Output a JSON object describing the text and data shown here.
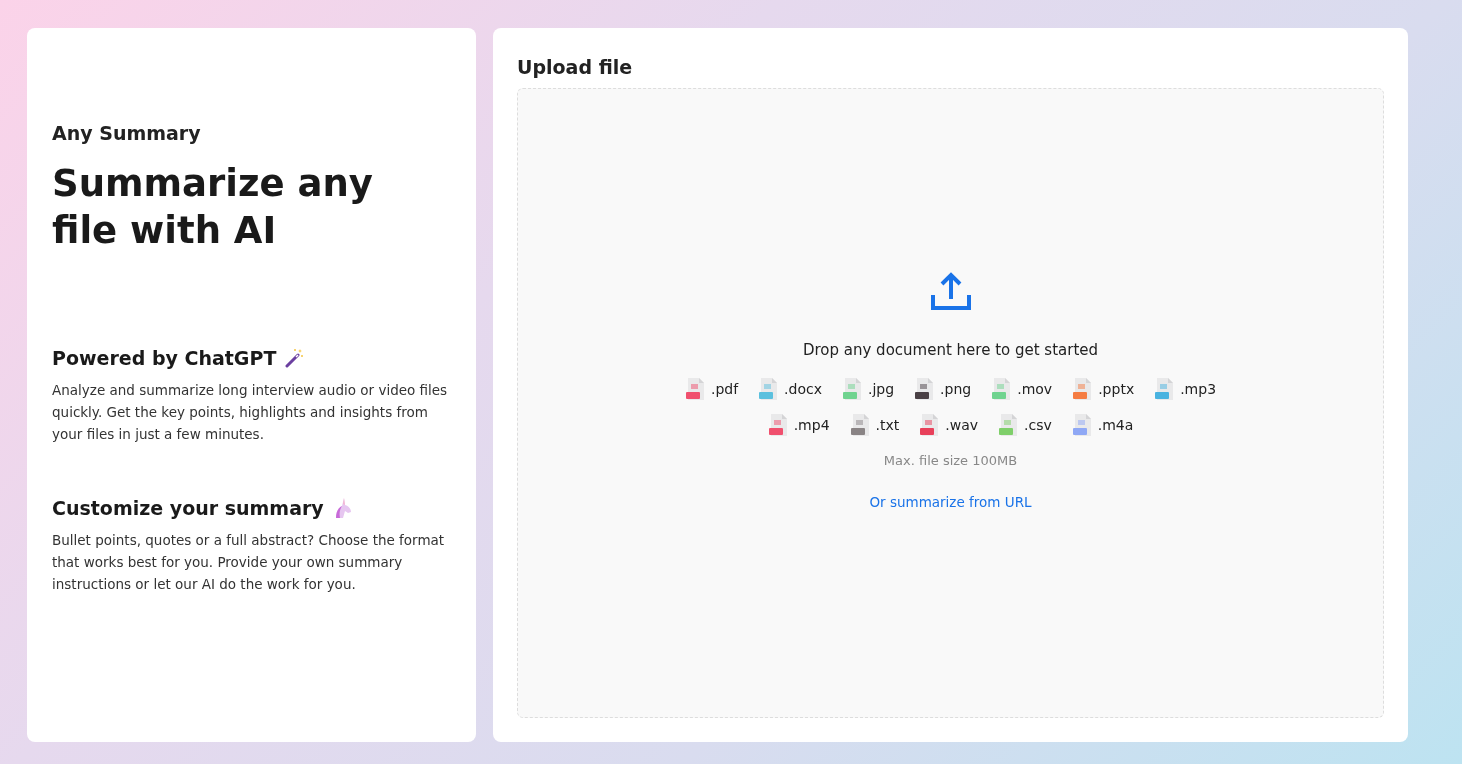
{
  "intro": {
    "brand": "Any Summary",
    "headline": "Summarize any file with AI"
  },
  "features": [
    {
      "title": "Powered by ChatGPT",
      "text": "Analyze and summarize long interview audio or video files quickly. Get the key points, highlights and insights from your files in just a few minutes."
    },
    {
      "title": "Customize your summary",
      "text": "Bullet points, quotes or a full abstract? Choose the format that works best for you. Provide your own summary instructions or let our AI do the work for you."
    }
  ],
  "upload": {
    "title": "Upload file",
    "prompt": "Drop any document here to get started",
    "file_types": [
      {
        "label": ".pdf",
        "color": "#f0506e"
      },
      {
        "label": ".docx",
        "color": "#5bc0de"
      },
      {
        "label": ".jpg",
        "color": "#6fd38f"
      },
      {
        "label": ".png",
        "color": "#4a4045"
      },
      {
        "label": ".mov",
        "color": "#6fd38f"
      },
      {
        "label": ".pptx",
        "color": "#f57c42"
      },
      {
        "label": ".mp3",
        "color": "#4ab3e0"
      },
      {
        "label": ".mp4",
        "color": "#f0506e"
      },
      {
        "label": ".txt",
        "color": "#8a8485"
      },
      {
        "label": ".wav",
        "color": "#e8405a"
      },
      {
        "label": ".csv",
        "color": "#7fcf6a"
      },
      {
        "label": ".m4a",
        "color": "#8fa8f5"
      }
    ],
    "limit": "Max. file size 100MB",
    "url_link": "Or summarize from URL"
  }
}
